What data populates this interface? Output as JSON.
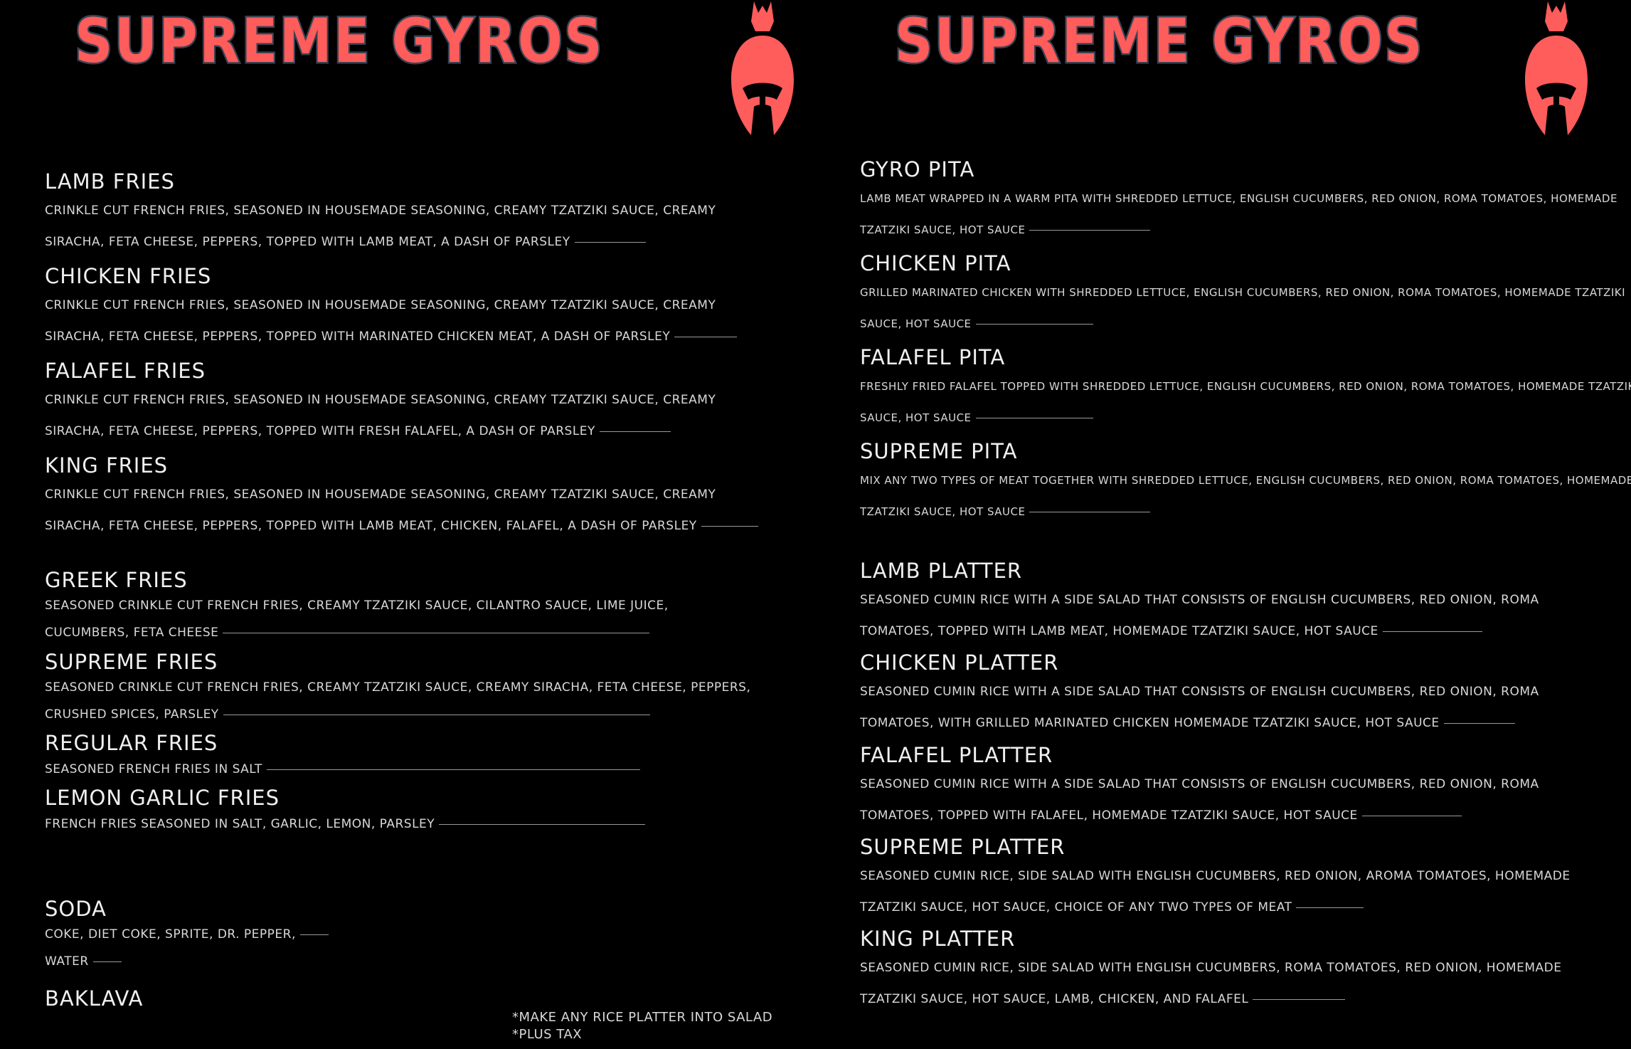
{
  "brand": "SUPREME GYROS",
  "left_page": {
    "items": [
      {
        "name": "LAMB FRIES",
        "lines": [
          "CRINKLE CUT FRENCH FRIES, SEASONED IN HOUSEMADE SEASONING, CREAMY TZATZIKI SAUCE, CREAMY",
          "SIRACHA, FETA CHEESE, PEPPERS, TOPPED WITH LAMB MEAT, A DASH OF PARSLEY"
        ]
      },
      {
        "name": "CHICKEN FRIES",
        "lines": [
          "CRINKLE CUT FRENCH FRIES, SEASONED IN HOUSEMADE SEASONING, CREAMY TZATZIKI SAUCE, CREAMY",
          "SIRACHA, FETA CHEESE, PEPPERS, TOPPED WITH MARINATED CHICKEN MEAT, A DASH OF PARSLEY"
        ]
      },
      {
        "name": "FALAFEL FRIES",
        "lines": [
          "CRINKLE CUT FRENCH FRIES, SEASONED IN HOUSEMADE SEASONING, CREAMY TZATZIKI SAUCE, CREAMY",
          "SIRACHA, FETA CHEESE, PEPPERS, TOPPED WITH FRESH FALAFEL, A DASH OF PARSLEY"
        ]
      },
      {
        "name": "KING FRIES",
        "lines": [
          "CRINKLE CUT FRENCH FRIES, SEASONED IN HOUSEMADE SEASONING, CREAMY TZATZIKI SAUCE, CREAMY",
          "SIRACHA, FETA CHEESE, PEPPERS, TOPPED WITH LAMB MEAT, CHICKEN, FALAFEL, A DASH OF PARSLEY"
        ]
      },
      {
        "name": "GREEK FRIES",
        "lines": [
          "SEASONED CRINKLE CUT FRENCH FRIES, CREAMY TZATZIKI SAUCE, CILANTRO SAUCE, LIME JUICE,",
          "CUCUMBERS, FETA CHEESE"
        ]
      },
      {
        "name": "SUPREME FRIES",
        "lines": [
          "SEASONED CRINKLE CUT FRENCH FRIES, CREAMY TZATZIKI SAUCE, CREAMY SIRACHA, FETA CHEESE, PEPPERS,",
          "CRUSHED SPICES, PARSLEY"
        ]
      },
      {
        "name": "REGULAR FRIES",
        "lines": [
          "SEASONED FRENCH FRIES IN SALT"
        ]
      },
      {
        "name": "LEMON GARLIC FRIES",
        "lines": [
          "FRENCH FRIES SEASONED IN SALT, GARLIC, LEMON, PARSLEY"
        ]
      },
      {
        "name": "SODA",
        "lines": [
          "COKE, DIET COKE, SPRITE, DR. PEPPER,",
          "WATER"
        ]
      },
      {
        "name": "BAKLAVA",
        "lines": []
      }
    ],
    "notes": [
      "*MAKE ANY RICE PLATTER INTO SALAD",
      "*PLUS TAX"
    ]
  },
  "right_page": {
    "items": [
      {
        "name": "GYRO PITA",
        "lines": [
          "LAMB MEAT WRAPPED IN A WARM PITA WITH SHREDDED LETTUCE, ENGLISH CUCUMBERS, RED ONION, ROMA TOMATOES, HOMEMADE",
          "TZATZIKI SAUCE, HOT SAUCE"
        ]
      },
      {
        "name": "CHICKEN PITA",
        "lines": [
          "GRILLED MARINATED CHICKEN WITH SHREDDED LETTUCE, ENGLISH CUCUMBERS, RED ONION, ROMA TOMATOES, HOMEMADE TZATZIKI",
          "SAUCE, HOT SAUCE"
        ]
      },
      {
        "name": "FALAFEL PITA",
        "lines": [
          "FRESHLY FRIED FALAFEL TOPPED WITH SHREDDED LETTUCE, ENGLISH CUCUMBERS, RED ONION, ROMA TOMATOES, HOMEMADE TZATZIKI",
          "SAUCE, HOT SAUCE"
        ]
      },
      {
        "name": "SUPREME PITA",
        "lines": [
          "MIX ANY TWO TYPES OF MEAT TOGETHER WITH SHREDDED LETTUCE, ENGLISH CUCUMBERS, RED ONION, ROMA TOMATOES, HOMEMADE",
          "TZATZIKI SAUCE, HOT SAUCE"
        ]
      },
      {
        "name": "LAMB PLATTER",
        "lines": [
          "SEASONED CUMIN RICE WITH A SIDE SALAD THAT CONSISTS OF ENGLISH CUCUMBERS, RED ONION, ROMA",
          "TOMATOES, TOPPED WITH LAMB MEAT, HOMEMADE TZATZIKI SAUCE, HOT SAUCE"
        ]
      },
      {
        "name": "CHICKEN PLATTER",
        "lines": [
          "SEASONED CUMIN RICE WITH A SIDE SALAD THAT CONSISTS OF ENGLISH CUCUMBERS, RED ONION, ROMA",
          "TOMATOES, WITH GRILLED MARINATED CHICKEN HOMEMADE TZATZIKI SAUCE, HOT SAUCE"
        ]
      },
      {
        "name": "FALAFEL PLATTER",
        "lines": [
          "SEASONED CUMIN RICE WITH A SIDE SALAD THAT CONSISTS OF ENGLISH CUCUMBERS, RED ONION, ROMA",
          "TOMATOES, TOPPED WITH FALAFEL, HOMEMADE TZATZIKI SAUCE, HOT SAUCE"
        ]
      },
      {
        "name": "SUPREME PLATTER",
        "lines": [
          "SEASONED CUMIN RICE, SIDE SALAD WITH ENGLISH CUCUMBERS, RED ONION, AROMA TOMATOES, HOMEMADE",
          "TZATZIKI SAUCE, HOT SAUCE, CHOICE OF ANY TWO TYPES OF MEAT"
        ]
      },
      {
        "name": "KING PLATTER",
        "lines": [
          "SEASONED CUMIN RICE, SIDE SALAD WITH ENGLISH CUCUMBERS, ROMA TOMATOES, RED ONION, HOMEMADE",
          "TZATZIKI SAUCE, HOT SAUCE, LAMB, CHICKEN, AND FALAFEL"
        ]
      }
    ]
  },
  "colors": {
    "brand_fill": "#ff5c5c",
    "brand_outline": "#3a4252",
    "background": "#000000",
    "text": "#e6e6e6"
  },
  "icons": {
    "logo": "spartan-helmet-icon"
  }
}
